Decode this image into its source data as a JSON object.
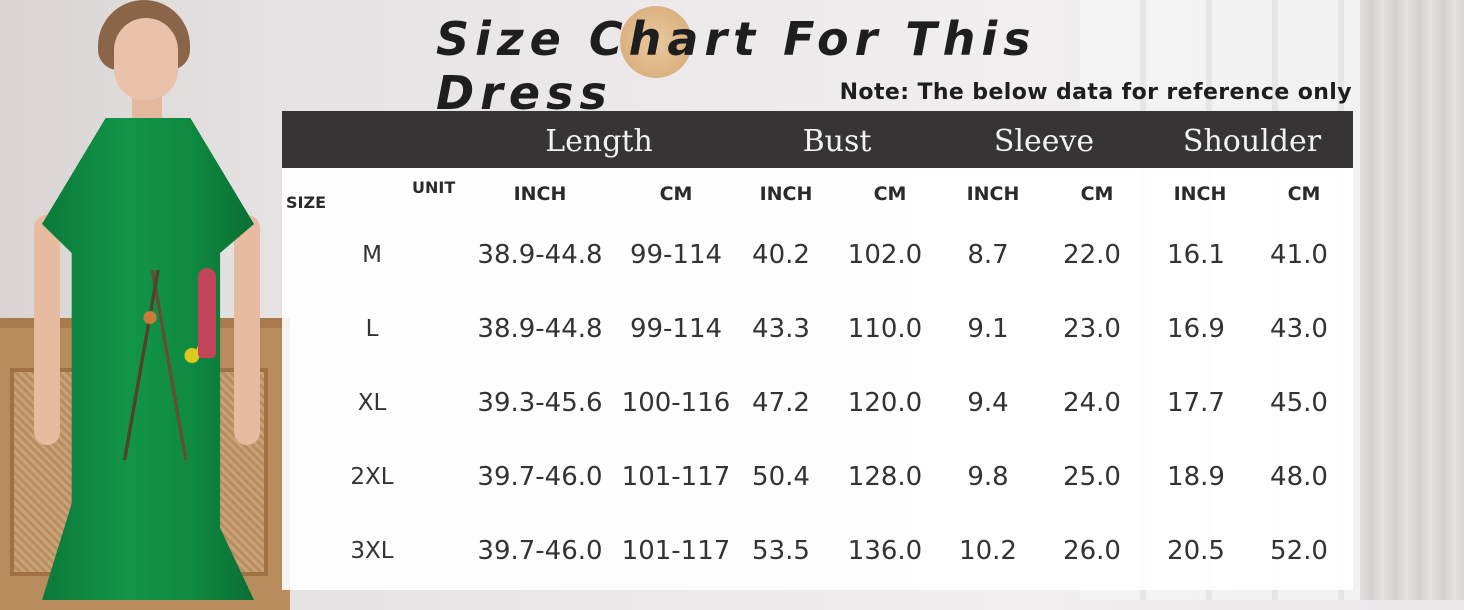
{
  "title": "Size Chart For This Dress",
  "note": "Note: The below data for reference only",
  "table": {
    "groups": [
      "Length",
      "Bust",
      "Sleeve",
      "Shoulder"
    ],
    "size_label": "SIZE",
    "unit_label": "UNIT",
    "subheaders": [
      "INCH",
      "CM",
      "INCH",
      "CM",
      "INCH",
      "CM",
      "INCH",
      "CM"
    ],
    "rows": [
      {
        "size": "M",
        "values": [
          "38.9-44.8",
          "99-114",
          "40.2",
          "102.0",
          "8.7",
          "22.0",
          "16.1",
          "41.0"
        ]
      },
      {
        "size": "L",
        "values": [
          "38.9-44.8",
          "99-114",
          "43.3",
          "110.0",
          "9.1",
          "23.0",
          "16.9",
          "43.0"
        ]
      },
      {
        "size": "XL",
        "values": [
          "39.3-45.6",
          "100-116",
          "47.2",
          "120.0",
          "9.4",
          "24.0",
          "17.7",
          "45.0"
        ]
      },
      {
        "size": "2XL",
        "values": [
          "39.7-46.0",
          "101-117",
          "50.4",
          "128.0",
          "9.8",
          "25.0",
          "18.9",
          "48.0"
        ]
      },
      {
        "size": "3XL",
        "values": [
          "39.7-46.0",
          "101-117",
          "53.5",
          "136.0",
          "10.2",
          "26.0",
          "20.5",
          "52.0"
        ]
      }
    ]
  },
  "colors": {
    "header_bg": "#363434",
    "header_text": "#f2f2f2",
    "dress_green": "#129548"
  }
}
